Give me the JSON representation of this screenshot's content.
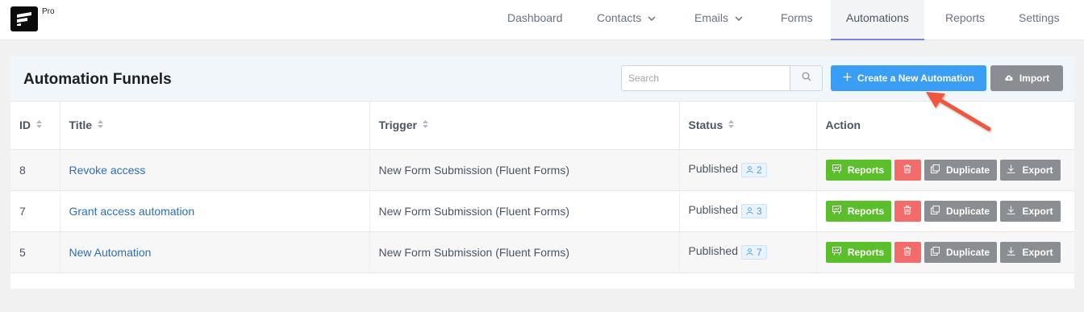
{
  "brand": {
    "tier": "Pro"
  },
  "nav": {
    "items": [
      {
        "label": "Dashboard",
        "dropdown": false
      },
      {
        "label": "Contacts",
        "dropdown": true
      },
      {
        "label": "Emails",
        "dropdown": true
      },
      {
        "label": "Forms",
        "dropdown": false
      },
      {
        "label": "Automations",
        "dropdown": false,
        "active": true
      },
      {
        "label": "Reports",
        "dropdown": false
      },
      {
        "label": "Settings",
        "dropdown": false
      }
    ]
  },
  "header": {
    "title": "Automation Funnels",
    "search_placeholder": "Search",
    "create_label": "Create a New Automation",
    "import_label": "Import"
  },
  "table": {
    "columns": [
      "ID",
      "Title",
      "Trigger",
      "Status",
      "Action"
    ],
    "rows": [
      {
        "id": "8",
        "title": "Revoke access",
        "trigger": "New Form Submission (Fluent Forms)",
        "status": "Published",
        "subscribers": "2"
      },
      {
        "id": "7",
        "title": "Grant access automation",
        "trigger": "New Form Submission (Fluent Forms)",
        "status": "Published",
        "subscribers": "3"
      },
      {
        "id": "5",
        "title": "New Automation",
        "trigger": "New Form Submission (Fluent Forms)",
        "status": "Published",
        "subscribers": "7"
      }
    ],
    "action_labels": {
      "reports": "Reports",
      "duplicate": "Duplicate",
      "export": "Export"
    }
  },
  "colors": {
    "primary": "#3a9ef5",
    "success": "#5bbf2c",
    "danger": "#f36b6b",
    "neutral": "#8a8d91",
    "link": "#2c6fb7",
    "annotation_arrow": "#f0553e"
  }
}
